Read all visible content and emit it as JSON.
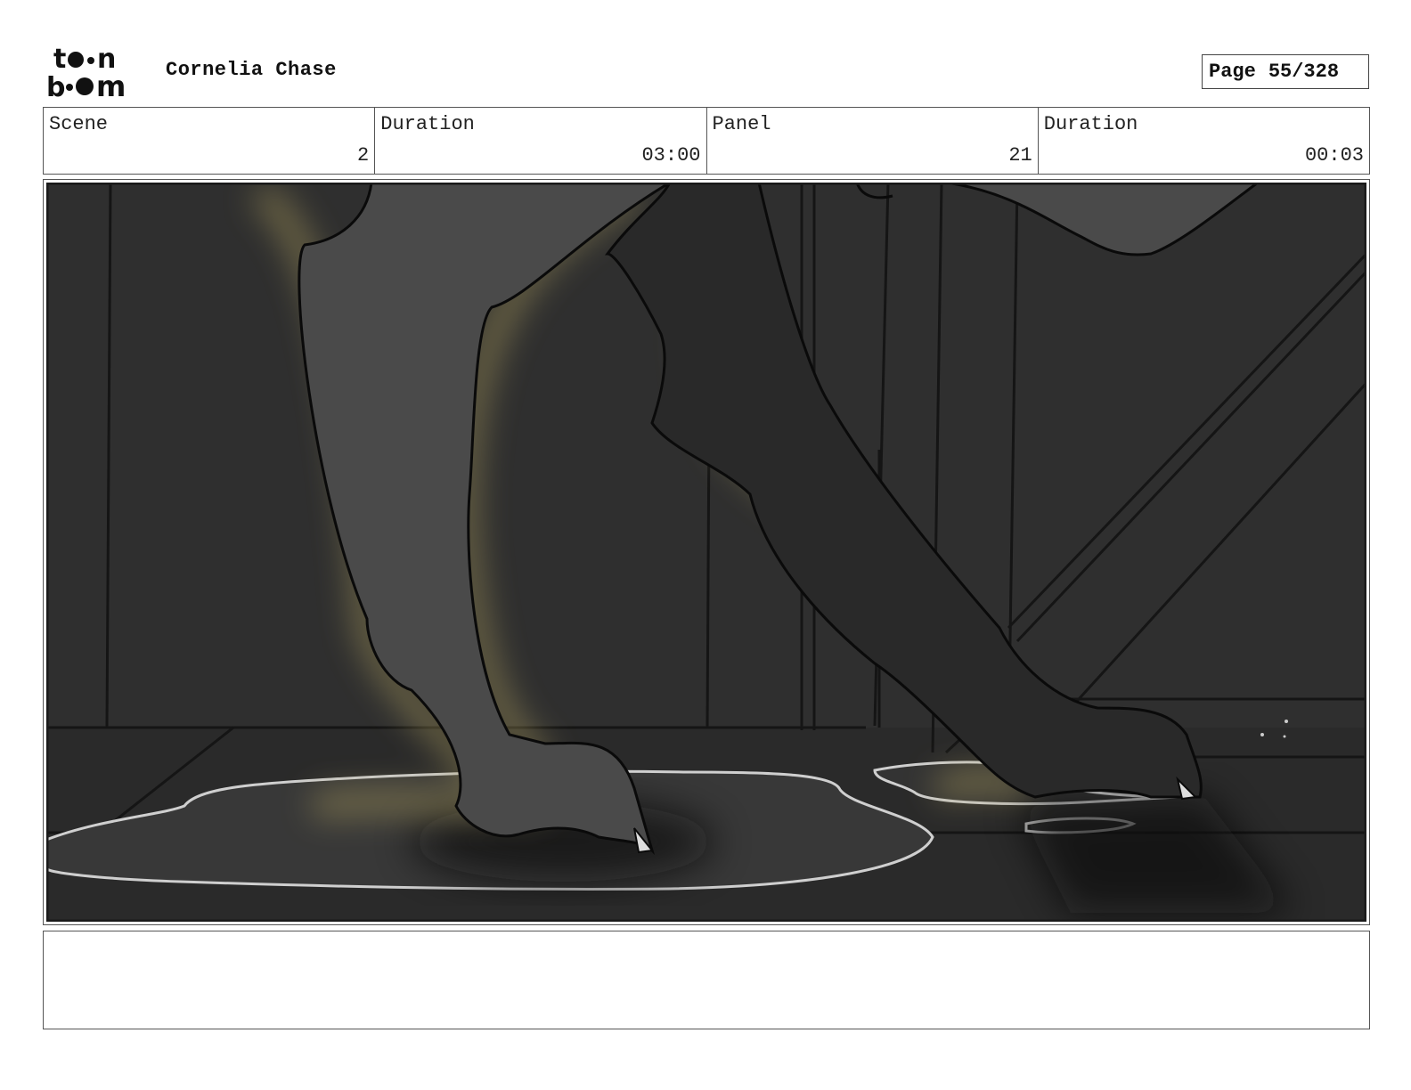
{
  "header": {
    "logo_text": "toon boom",
    "project_title": "Cornelia Chase",
    "page_label": "Page",
    "page_number": "55/328"
  },
  "info": {
    "scene_label": "Scene",
    "scene_value": "2",
    "scene_duration_label": "Duration",
    "scene_duration_value": "03:00",
    "panel_label": "Panel",
    "panel_value": "21",
    "panel_duration_label": "Duration",
    "panel_duration_value": "00:03"
  },
  "colors": {
    "background_dark": "#2e2e2e",
    "character_grey": "#4a4a4a",
    "glow_yellow": "#a89a5c",
    "puddle_outline": "#d0d0d0"
  },
  "notes": ""
}
